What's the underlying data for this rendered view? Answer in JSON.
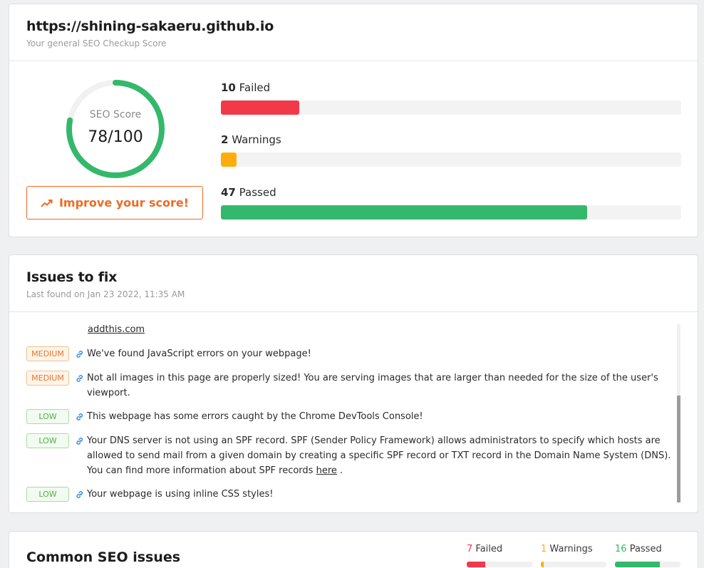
{
  "header": {
    "url": "https://shining-sakaeru.github.io",
    "subtitle": "Your general SEO Checkup Score"
  },
  "score": {
    "label": "SEO Score",
    "value_text": "78/100",
    "value": 78,
    "max": 100,
    "color": "#34b86b",
    "track_color": "#f1f1f1"
  },
  "improve_button": {
    "label": "Improve your score!",
    "icon": "trending-up-icon",
    "color": "#ee6a24"
  },
  "stats": [
    {
      "count": "10",
      "label": "Failed",
      "fraction": 0.17,
      "color": "#f2394a"
    },
    {
      "count": "2",
      "label": "Warnings",
      "fraction": 0.034,
      "color": "#ffad0d"
    },
    {
      "count": "47",
      "label": "Passed",
      "fraction": 0.796,
      "color": "#34b86b"
    }
  ],
  "issues": {
    "title": "Issues to fix",
    "subtitle": "Last found on Jan 23 2022, 11:35 AM",
    "top_link": "addthis.com",
    "items": [
      {
        "severity": "MEDIUM",
        "text": "We've found JavaScript errors on your webpage!"
      },
      {
        "severity": "MEDIUM",
        "text": "Not all images in this page are properly sized! You are serving images that are larger than needed for the size of the user's viewport."
      },
      {
        "severity": "LOW",
        "text": "This webpage has some errors caught by the Chrome DevTools Console!"
      },
      {
        "severity": "LOW",
        "text": "Your DNS server is not using an SPF record. SPF (Sender Policy Framework) allows administrators to specify which hosts are allowed to send mail from a given domain by creating a specific SPF record or TXT record in the Domain Name System (DNS). You can find more information about SPF records",
        "link": "here",
        "suffix": " ."
      },
      {
        "severity": "LOW",
        "text": "Your webpage is using inline CSS styles!"
      }
    ],
    "scroll_position": 0.4
  },
  "common": {
    "title": "Common SEO issues",
    "stats": [
      {
        "count": "7",
        "label": "Failed",
        "fraction": 0.28,
        "color": "#f2394a"
      },
      {
        "count": "1",
        "label": "Warnings",
        "fraction": 0.04,
        "color": "#ffad0d"
      },
      {
        "count": "16",
        "label": "Passed",
        "fraction": 0.68,
        "color": "#34b86b"
      }
    ]
  }
}
